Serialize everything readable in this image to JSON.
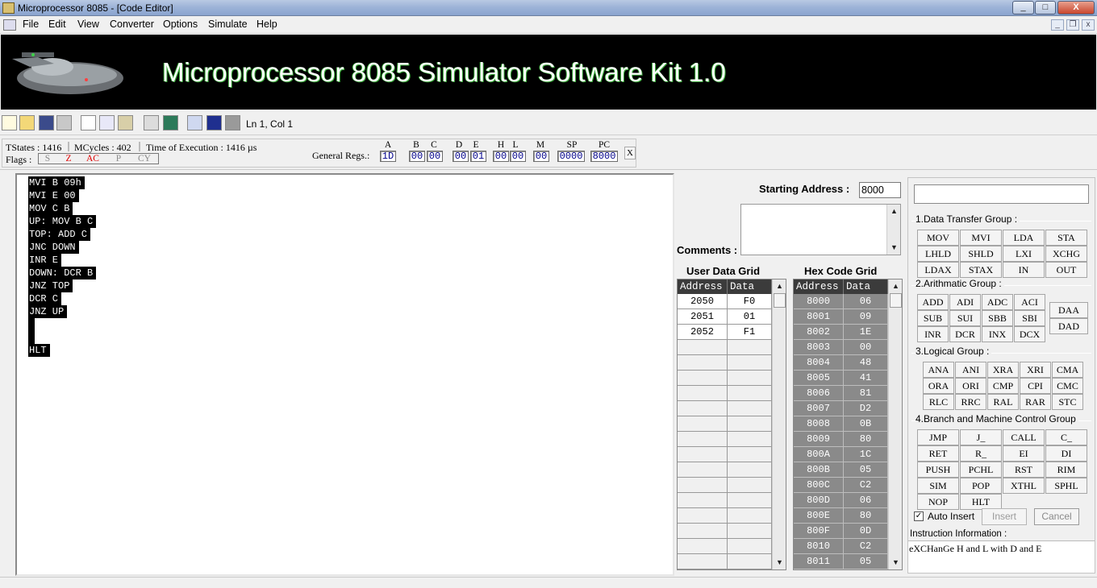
{
  "window": {
    "title": "Microprocessor 8085 - [Code Editor]",
    "min": "_",
    "max": "□",
    "close": "X"
  },
  "menu": [
    "File",
    "Edit",
    "View",
    "Converter",
    "Options",
    "Simulate",
    "Help"
  ],
  "mdi": {
    "min": "_",
    "restore": "❐",
    "close": "x"
  },
  "banner": {
    "title": "Microprocessor 8085 Simulator Software Kit 1.0"
  },
  "toolbar": {
    "status": "Ln 1, Col 1"
  },
  "stats": {
    "tstates": "TStates : 1416",
    "mcycles": "MCycles : 402",
    "time": "Time of Execution : 1416 µs",
    "flags_label": "Flags :",
    "general_regs": "General Regs.:",
    "close": "X"
  },
  "flags": [
    {
      "name": "S",
      "color": "#8a8a8a"
    },
    {
      "name": "Z",
      "color": "#e00000"
    },
    {
      "name": "AC",
      "color": "#e00000"
    },
    {
      "name": "P",
      "color": "#8a8a8a"
    },
    {
      "name": "CY",
      "color": "#8a8a8a"
    }
  ],
  "registers": [
    {
      "label": "A",
      "value": "1D"
    },
    {
      "label": "B",
      "value": "00"
    },
    {
      "label": "C",
      "value": "00"
    },
    {
      "label": "D",
      "value": "00"
    },
    {
      "label": "E",
      "value": "01"
    },
    {
      "label": "H",
      "value": "00"
    },
    {
      "label": "L",
      "value": "00"
    },
    {
      "label": "M",
      "value": "00"
    },
    {
      "label": "SP",
      "value": "0000"
    },
    {
      "label": "PC",
      "value": "8000"
    }
  ],
  "code": [
    "MVI B 09h",
    "MVI E 00",
    "MOV C B",
    "UP: MOV B C",
    "TOP: ADD C",
    "JNC DOWN",
    "INR E",
    "DOWN: DCR B",
    "JNZ TOP",
    "DCR C",
    "JNZ UP",
    "",
    "",
    "HLT"
  ],
  "starting_address": {
    "label": "Starting Address :",
    "value": "8000"
  },
  "comments": {
    "label": "Comments :"
  },
  "user_grid": {
    "title": "User Data Grid",
    "headers": [
      "Address",
      "Data"
    ],
    "rows": [
      [
        "2050",
        "F0"
      ],
      [
        "2051",
        "01"
      ],
      [
        "2052",
        "F1"
      ]
    ]
  },
  "hex_grid": {
    "title": "Hex Code Grid",
    "headers": [
      "Address",
      "Data"
    ],
    "rows": [
      [
        "8000",
        "06"
      ],
      [
        "8001",
        "09"
      ],
      [
        "8002",
        "1E"
      ],
      [
        "8003",
        "00"
      ],
      [
        "8004",
        "48"
      ],
      [
        "8005",
        "41"
      ],
      [
        "8006",
        "81"
      ],
      [
        "8007",
        "D2"
      ],
      [
        "8008",
        "0B"
      ],
      [
        "8009",
        "80"
      ],
      [
        "800A",
        "1C"
      ],
      [
        "800B",
        "05"
      ],
      [
        "800C",
        "C2"
      ],
      [
        "800D",
        "06"
      ],
      [
        "800E",
        "80"
      ],
      [
        "800F",
        "0D"
      ],
      [
        "8010",
        "C2"
      ],
      [
        "8011",
        "05"
      ]
    ]
  },
  "groups": [
    {
      "title": "1.Data Transfer Group :",
      "buttons": [
        "MOV",
        "MVI",
        "LDA",
        "STA",
        "LHLD",
        "SHLD",
        "LXI",
        "XCHG",
        "LDAX",
        "STAX",
        "IN",
        "OUT"
      ]
    },
    {
      "title": "2.Arithmatic Group :",
      "buttons": [
        "ADD",
        "ADI",
        "ADC",
        "ACI",
        "SUB",
        "SUI",
        "SBB",
        "SBI",
        "INR",
        "DCR",
        "INX",
        "DCX"
      ],
      "extra": [
        "DAA",
        "DAD"
      ]
    },
    {
      "title": "3.Logical Group :",
      "buttons": [
        "ANA",
        "ANI",
        "XRA",
        "XRI",
        "CMA",
        "ORA",
        "ORI",
        "CMP",
        "CPI",
        "CMC",
        "RLC",
        "RRC",
        "RAL",
        "RAR",
        "STC"
      ]
    },
    {
      "title": "4.Branch and Machine Control Group",
      "buttons": [
        "JMP",
        "J_",
        "CALL",
        "C_",
        "RET",
        "R_",
        "EI",
        "DI",
        "PUSH",
        "PCHL",
        "RST",
        "RIM",
        "SIM",
        "POP",
        "XTHL",
        "SPHL",
        "NOP",
        "HLT"
      ]
    }
  ],
  "auto_insert": {
    "label": "Auto Insert",
    "check": "✓"
  },
  "actions": {
    "insert": "Insert",
    "cancel": "Cancel"
  },
  "instruction_info": {
    "label": "Instruction Information :",
    "text": "eXCHanGe H and L with D and E"
  }
}
